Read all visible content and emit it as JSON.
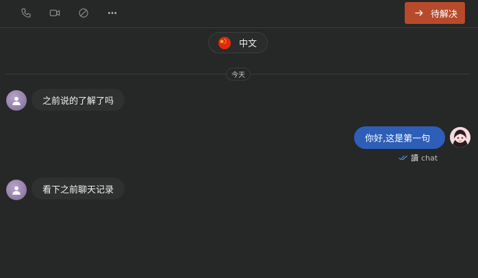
{
  "toolbar": {
    "icons": [
      "phone-icon",
      "video-icon",
      "block-icon",
      "more-icon"
    ],
    "resolve_label": "待解决",
    "resolve_color": "#b84a2c"
  },
  "language": {
    "label": "中文",
    "flag": "china-flag-icon"
  },
  "date_divider": "今天",
  "messages": [
    {
      "direction": "in",
      "text": "之前说的了解了吗"
    },
    {
      "direction": "out",
      "text": "你好,这是第一句",
      "read_mark": "讀",
      "sender": "chat"
    },
    {
      "direction": "in",
      "text": "看下之前聊天记录"
    }
  ],
  "colors": {
    "background": "#262727",
    "outgoing_bubble": "#2d5fb8",
    "incoming_bubble": "#2f3030",
    "read_tick": "#4a8de0"
  }
}
